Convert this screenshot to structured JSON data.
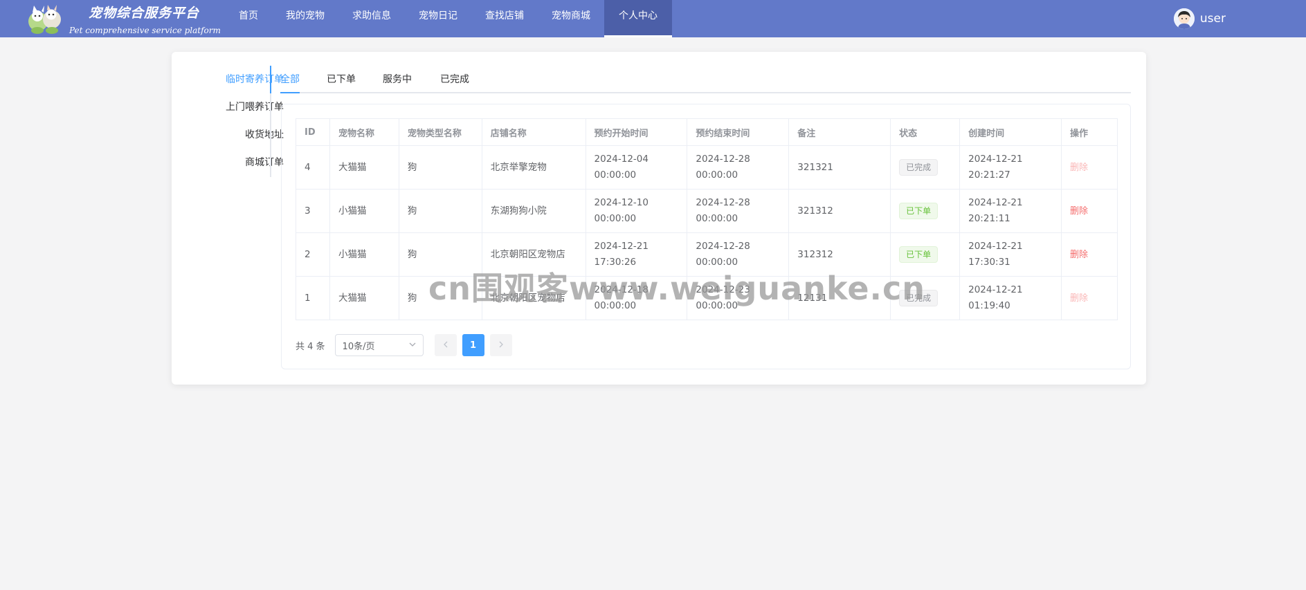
{
  "brand": {
    "title": "宠物综合服务平台",
    "subtitle": "Pet comprehensive service platform"
  },
  "nav": {
    "items": [
      {
        "label": "首页",
        "active": false
      },
      {
        "label": "我的宠物",
        "active": false
      },
      {
        "label": "求助信息",
        "active": false
      },
      {
        "label": "宠物日记",
        "active": false
      },
      {
        "label": "查找店铺",
        "active": false
      },
      {
        "label": "宠物商城",
        "active": false
      },
      {
        "label": "个人中心",
        "active": true
      }
    ]
  },
  "user": {
    "name": "user"
  },
  "sidebar": {
    "items": [
      {
        "label": "临时寄养订单",
        "active": true
      },
      {
        "label": "上门喂养订单",
        "active": false
      },
      {
        "label": "收货地址",
        "active": false
      },
      {
        "label": "商城订单",
        "active": false
      }
    ]
  },
  "tabs": [
    {
      "label": "全部",
      "active": true
    },
    {
      "label": "已下单",
      "active": false
    },
    {
      "label": "服务中",
      "active": false
    },
    {
      "label": "已完成",
      "active": false
    }
  ],
  "table": {
    "headers": [
      "ID",
      "宠物名称",
      "宠物类型名称",
      "店铺名称",
      "预约开始时间",
      "预约结束时间",
      "备注",
      "状态",
      "创建时间",
      "操作"
    ],
    "rows": [
      {
        "id": "4",
        "pet_name": "大猫猫",
        "pet_type": "狗",
        "store": "北京举擎宠物",
        "start_date": "2024-12-04",
        "start_time": "00:00:00",
        "end_date": "2024-12-28",
        "end_time": "00:00:00",
        "note": "321321",
        "status": "已完成",
        "status_type": "done",
        "created_date": "2024-12-21",
        "created_time": "20:21:27",
        "action": "删除",
        "action_enabled": false
      },
      {
        "id": "3",
        "pet_name": "小猫猫",
        "pet_type": "狗",
        "store": "东湖狗狗小院",
        "start_date": "2024-12-10",
        "start_time": "00:00:00",
        "end_date": "2024-12-28",
        "end_time": "00:00:00",
        "note": "321312",
        "status": "已下单",
        "status_type": "ordered",
        "created_date": "2024-12-21",
        "created_time": "20:21:11",
        "action": "删除",
        "action_enabled": true
      },
      {
        "id": "2",
        "pet_name": "小猫猫",
        "pet_type": "狗",
        "store": "北京朝阳区宠物店",
        "start_date": "2024-12-21",
        "start_time": "17:30:26",
        "end_date": "2024-12-28",
        "end_time": "00:00:00",
        "note": "312312",
        "status": "已下单",
        "status_type": "ordered",
        "created_date": "2024-12-21",
        "created_time": "17:30:31",
        "action": "删除",
        "action_enabled": true
      },
      {
        "id": "1",
        "pet_name": "大猫猫",
        "pet_type": "狗",
        "store": "北京朝阳区宠物店",
        "start_date": "2024-12-18",
        "start_time": "00:00:00",
        "end_date": "2024-12-23",
        "end_time": "00:00:00",
        "note": "12131",
        "status": "已完成",
        "status_type": "done",
        "created_date": "2024-12-21",
        "created_time": "01:19:40",
        "action": "删除",
        "action_enabled": false
      }
    ]
  },
  "pagination": {
    "total_text": "共 4 条",
    "page_size": "10条/页",
    "current_page": "1"
  },
  "watermark": "cn围观客www.weiguanke.cn",
  "colors": {
    "navbar": "#6279c9",
    "nav_active": "#4c5fa8",
    "accent": "#409eff",
    "success": "#67c23a",
    "danger": "#f56c6c"
  }
}
